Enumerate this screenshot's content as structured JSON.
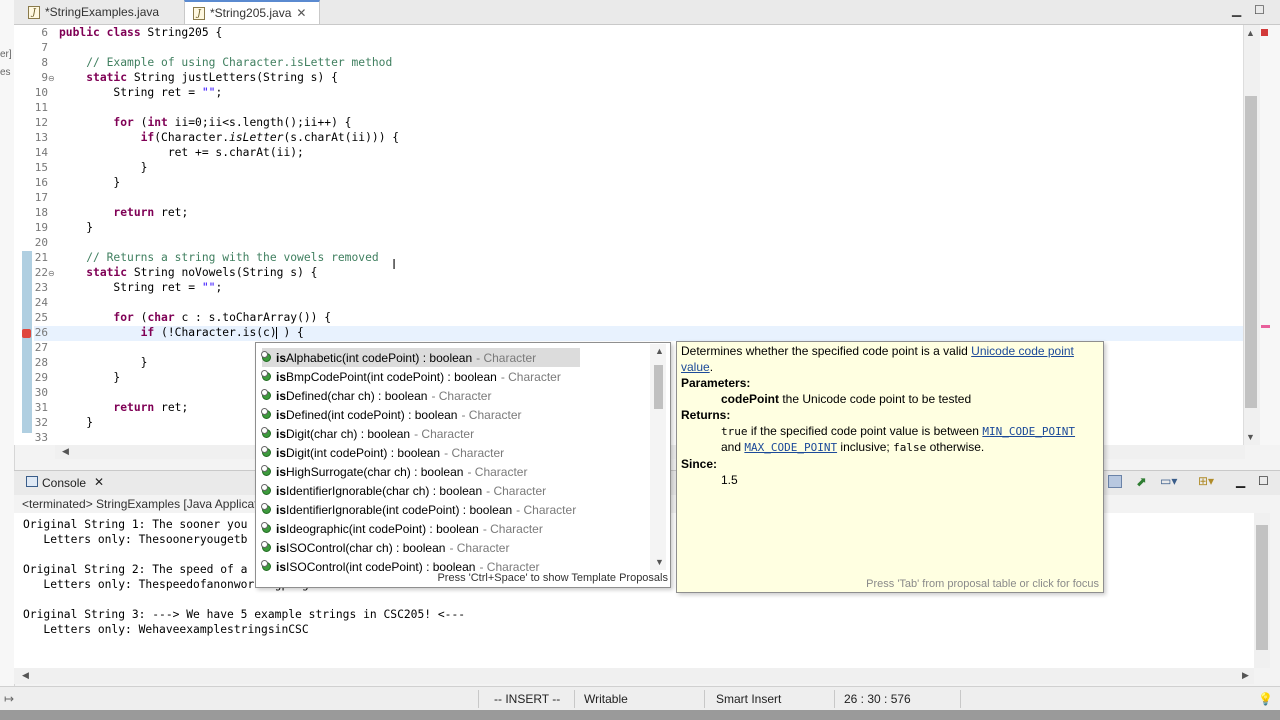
{
  "tabs": [
    {
      "label": "*StringExamples.java",
      "active": false
    },
    {
      "label": "*String205.java",
      "active": true
    }
  ],
  "left_strip": [
    "er]",
    "es"
  ],
  "editor": {
    "lines": [
      {
        "n": "6",
        "html": "<span class=\"kw\">public class</span> String205 {"
      },
      {
        "n": "7",
        "html": ""
      },
      {
        "n": "8",
        "html": "    <span class=\"cm\">// Example of using Character.isLetter method</span>"
      },
      {
        "n": "9",
        "html": "    <span class=\"kw\">static</span> String justLetters(String s) {"
      },
      {
        "n": "10",
        "html": "        String ret = <span class=\"str\">\"\"</span>;"
      },
      {
        "n": "11",
        "html": ""
      },
      {
        "n": "12",
        "html": "        <span class=\"kw\">for</span> (<span class=\"kw\">int</span> ii=0;ii&lt;s.length();ii++) {"
      },
      {
        "n": "13",
        "html": "            <span class=\"kw\">if</span>(Character.<span class=\"it\">isLetter</span>(s.charAt(ii))) {"
      },
      {
        "n": "14",
        "html": "                ret += s.charAt(ii);"
      },
      {
        "n": "15",
        "html": "            }"
      },
      {
        "n": "16",
        "html": "        }"
      },
      {
        "n": "17",
        "html": ""
      },
      {
        "n": "18",
        "html": "        <span class=\"kw\">return</span> ret;"
      },
      {
        "n": "19",
        "html": "    }"
      },
      {
        "n": "20",
        "html": ""
      },
      {
        "n": "21",
        "html": "    <span class=\"cm\">// Returns a string with the vowels removed</span>"
      },
      {
        "n": "22",
        "html": "    <span class=\"kw\">static</span> String noVowels(String s) {"
      },
      {
        "n": "23",
        "html": "        String ret = <span class=\"str\">\"\"</span>;"
      },
      {
        "n": "24",
        "html": ""
      },
      {
        "n": "25",
        "html": "        <span class=\"kw\">for</span> (<span class=\"kw\">char</span> c : s.toCharArray()) {"
      },
      {
        "n": "26",
        "html": "            <span class=\"kw\">if</span> (!Character.is(c) ) {"
      },
      {
        "n": "27",
        "html": ""
      },
      {
        "n": "28",
        "html": "            }"
      },
      {
        "n": "29",
        "html": "        }"
      },
      {
        "n": "30",
        "html": ""
      },
      {
        "n": "31",
        "html": "        <span class=\"kw\">return</span> ret;"
      },
      {
        "n": "32",
        "html": "    }"
      },
      {
        "n": "33",
        "html": ""
      }
    ]
  },
  "console": {
    "tab_label": "Console",
    "sub_label": "<terminated> StringExamples [Java Applicat",
    "lines": [
      "Original String 1: The sooner you",
      "   Letters only: Thesooneryougetb",
      "",
      "Original String 2: The speed of a",
      "   Letters only: Thespeedofanonworkingprogramisirrelevant",
      "",
      "Original String 3: ---> We have 5 example strings in CSC205! <---",
      "   Letters only: WehaveexamplestringsinCSC"
    ]
  },
  "status": {
    "mode": "-- INSERT --",
    "writable": "Writable",
    "insert": "Smart Insert",
    "position": "26 : 30 : 576"
  },
  "assist": {
    "proposals": [
      {
        "prefix": "is",
        "rest": "Alphabetic(int codePoint) : boolean",
        "owner": "- Character",
        "selected": true
      },
      {
        "prefix": "is",
        "rest": "BmpCodePoint(int codePoint) : boolean",
        "owner": "- Character",
        "selected": false
      },
      {
        "prefix": "is",
        "rest": "Defined(char ch) : boolean",
        "owner": "- Character",
        "selected": false
      },
      {
        "prefix": "is",
        "rest": "Defined(int codePoint) : boolean",
        "owner": "- Character",
        "selected": false
      },
      {
        "prefix": "is",
        "rest": "Digit(char ch) : boolean",
        "owner": "- Character",
        "selected": false
      },
      {
        "prefix": "is",
        "rest": "Digit(int codePoint) : boolean",
        "owner": "- Character",
        "selected": false
      },
      {
        "prefix": "is",
        "rest": "HighSurrogate(char ch) : boolean",
        "owner": "- Character",
        "selected": false
      },
      {
        "prefix": "is",
        "rest": "IdentifierIgnorable(char ch) : boolean",
        "owner": "- Character",
        "selected": false
      },
      {
        "prefix": "is",
        "rest": "IdentifierIgnorable(int codePoint) : boolean",
        "owner": "- Character",
        "selected": false
      },
      {
        "prefix": "is",
        "rest": "Ideographic(int codePoint) : boolean",
        "owner": "- Character",
        "selected": false
      },
      {
        "prefix": "is",
        "rest": "ISOControl(char ch) : boolean",
        "owner": "- Character",
        "selected": false
      },
      {
        "prefix": "is",
        "rest": "ISOControl(int codePoint) : boolean",
        "owner": "- Character",
        "selected": false
      }
    ],
    "hint": "Press 'Ctrl+Space' to show Template Proposals"
  },
  "doc": {
    "intro_before": "Determines whether the specified code point is a valid ",
    "intro_link1": "Unicode code point",
    "intro_link2": "value",
    "intro_after": ".",
    "params_label": "Parameters:",
    "param_name": "codePoint",
    "param_desc": " the Unicode code point to be tested",
    "returns_label": "Returns:",
    "returns_true": "true",
    "returns_mid": " if the specified code point value is between ",
    "returns_min": "MIN_CODE_POINT",
    "returns_and": "and ",
    "returns_max": "MAX_CODE_POINT",
    "returns_inclusive": " inclusive; ",
    "returns_false": "false",
    "returns_end": " otherwise.",
    "since_label": "Since:",
    "since_value": "1.5",
    "hint": "Press 'Tab' from proposal table or click for focus"
  }
}
